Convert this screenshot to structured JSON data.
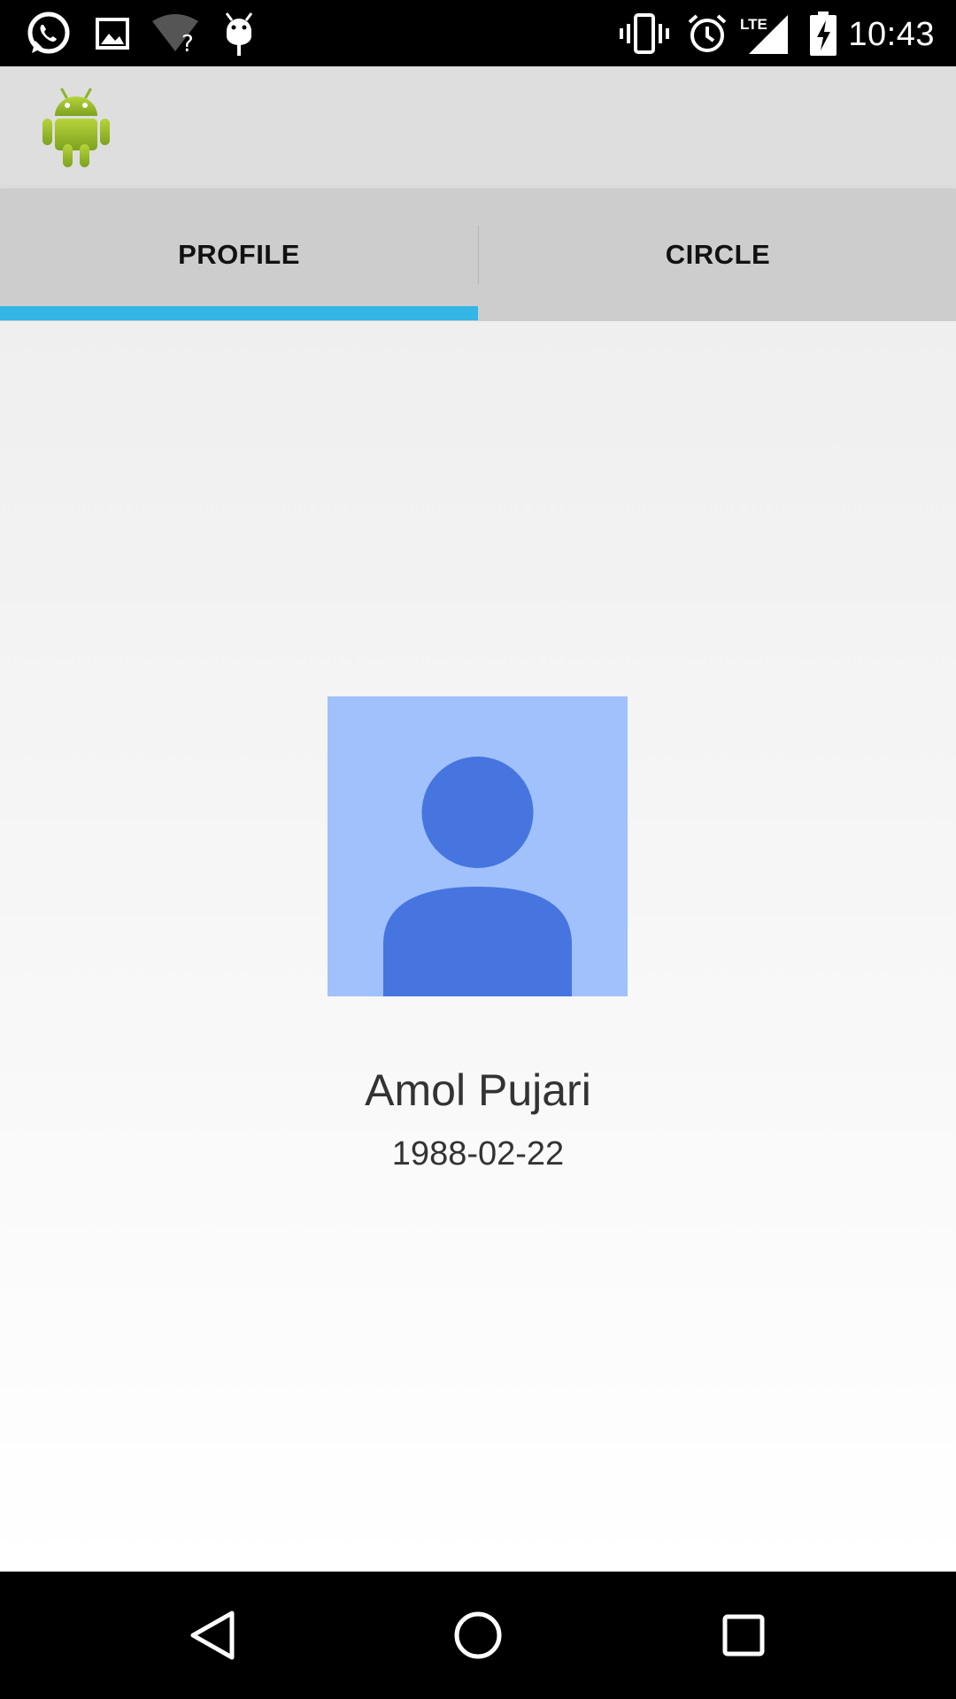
{
  "status_bar": {
    "time": "10:43",
    "network_label": "LTE",
    "left_icons": [
      "whatsapp-icon",
      "gallery-icon",
      "wifi-unknown-icon",
      "bug-icon"
    ],
    "right_icons": [
      "vibrate-icon",
      "alarm-icon",
      "lte-signal-icon",
      "battery-charging-icon"
    ]
  },
  "action_bar": {
    "logo": "android-logo-icon"
  },
  "tabs": [
    {
      "label": "PROFILE",
      "selected": true
    },
    {
      "label": "CIRCLE",
      "selected": false
    }
  ],
  "colors": {
    "tab_indicator": "#33b5e5",
    "avatar_bg": "#a0c1fb",
    "avatar_fg": "#4675e0"
  },
  "profile": {
    "name": "Amol Pujari",
    "dob": "1988-02-22",
    "avatar": "person-placeholder-icon"
  },
  "nav_bar": {
    "buttons": [
      "back-icon",
      "home-icon",
      "recents-icon"
    ]
  }
}
